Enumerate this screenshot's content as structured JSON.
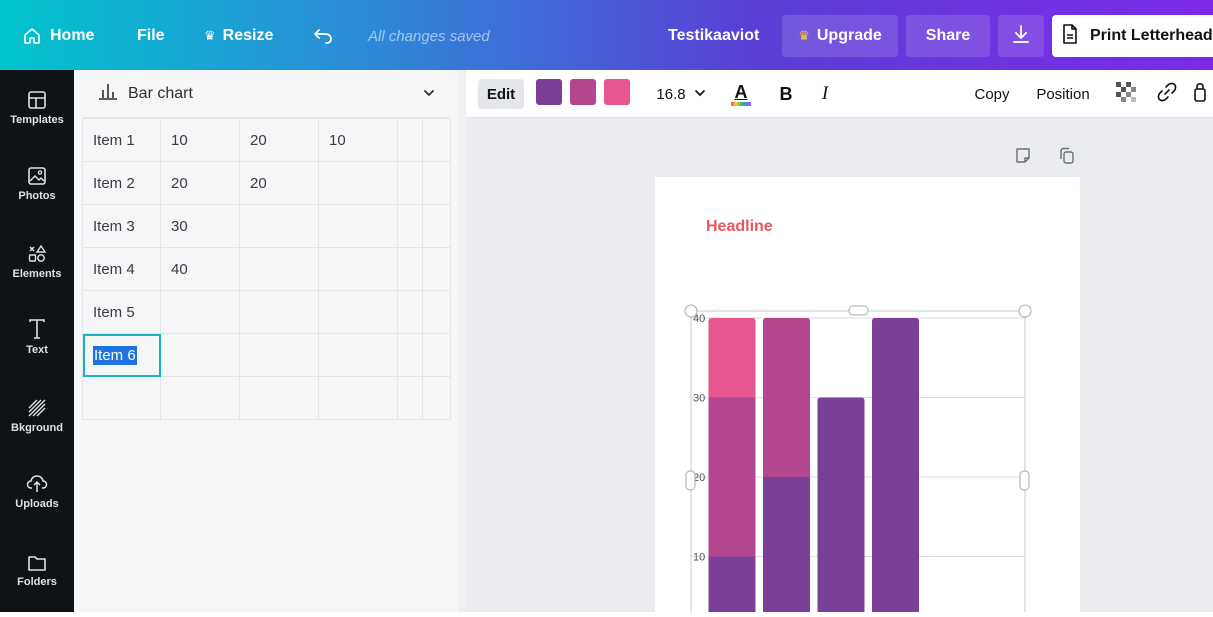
{
  "topbar": {
    "home_label": "Home",
    "file_label": "File",
    "resize_label": "Resize",
    "saved_status": "All changes saved",
    "doc_title": "Testikaaviot",
    "upgrade_label": "Upgrade",
    "share_label": "Share",
    "print_label": "Print Letterhead"
  },
  "sidebar": {
    "items": [
      {
        "label": "Templates",
        "icon": "templates-icon"
      },
      {
        "label": "Photos",
        "icon": "photos-icon"
      },
      {
        "label": "Elements",
        "icon": "elements-icon"
      },
      {
        "label": "Text",
        "icon": "text-icon"
      },
      {
        "label": "Bkground",
        "icon": "background-icon"
      },
      {
        "label": "Uploads",
        "icon": "uploads-icon"
      },
      {
        "label": "Folders",
        "icon": "folders-icon"
      }
    ]
  },
  "panel": {
    "chart_type_label": "Bar chart",
    "table": [
      [
        "Item 1",
        "10",
        "20",
        "10",
        "",
        ""
      ],
      [
        "Item 2",
        "20",
        "20",
        "",
        "",
        ""
      ],
      [
        "Item 3",
        "30",
        "",
        "",
        "",
        ""
      ],
      [
        "Item 4",
        "40",
        "",
        "",
        "",
        ""
      ],
      [
        "Item 5",
        "",
        "",
        "",
        "",
        ""
      ],
      [
        "Item 6",
        "",
        "",
        "",
        "",
        ""
      ],
      [
        "",
        "",
        "",
        "",
        "",
        ""
      ]
    ],
    "selected_cell": "Item 6"
  },
  "toolbar": {
    "edit_label": "Edit",
    "swatch_colors": [
      "#7b3f98",
      "#b3478f",
      "#e8568f"
    ],
    "font_size": "16.8",
    "text_color_glyph": "A",
    "bold_glyph": "B",
    "italic_glyph": "I",
    "copy_label": "Copy",
    "position_label": "Position"
  },
  "canvas": {
    "headline": "Headline"
  },
  "chart_data": {
    "type": "bar",
    "stacked": true,
    "categories": [
      "Item 1",
      "Item 2",
      "Item 3",
      "Item 4"
    ],
    "series": [
      {
        "values": [
          10,
          20,
          30,
          40
        ],
        "color": "#7b3f98"
      },
      {
        "values": [
          20,
          20,
          0,
          0
        ],
        "color": "#b3478f"
      },
      {
        "values": [
          10,
          0,
          0,
          0
        ],
        "color": "#e8568f"
      }
    ],
    "ylim": [
      0,
      40
    ],
    "yticks": [
      "10",
      "20",
      "30",
      "40"
    ],
    "grid": true
  }
}
